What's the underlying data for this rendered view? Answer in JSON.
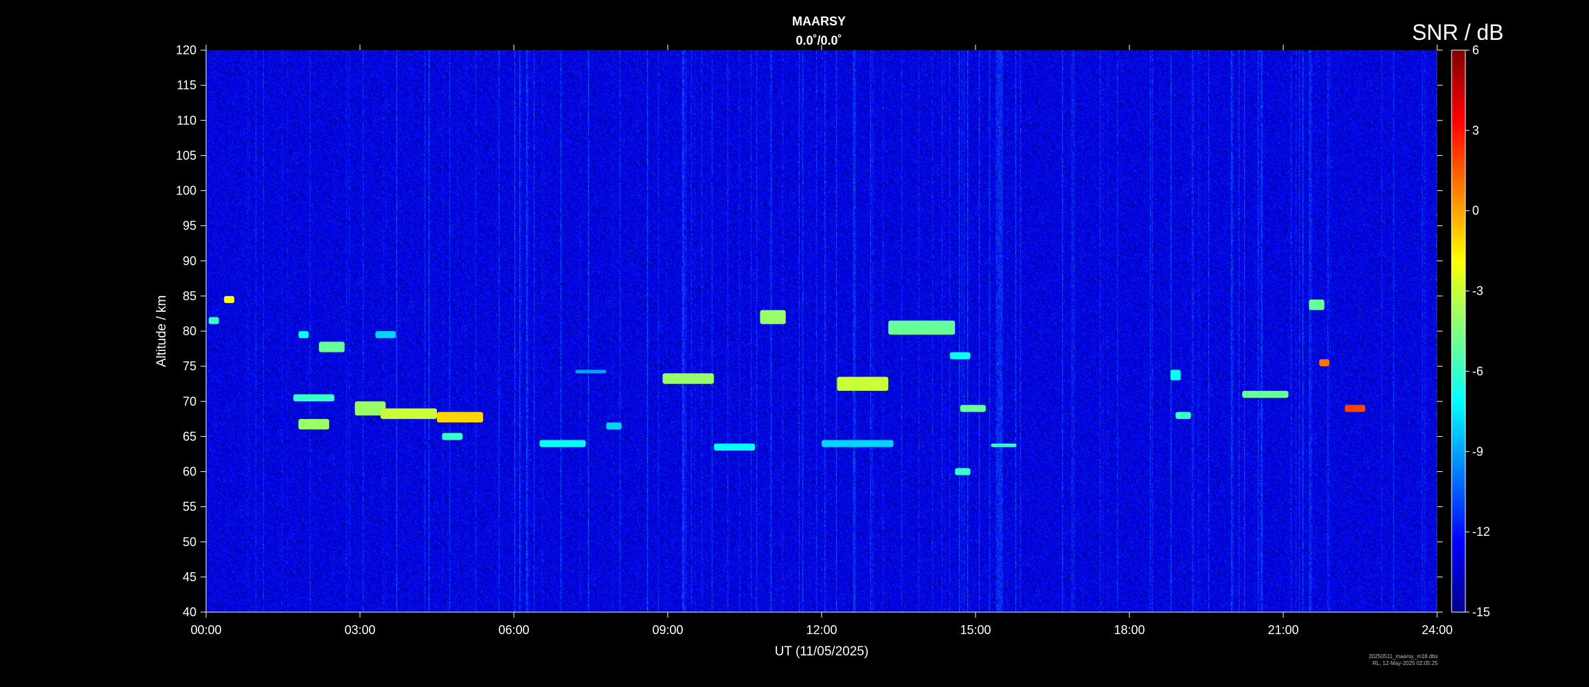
{
  "chart_data": {
    "type": "heatmap",
    "title": "MAARSY",
    "subtitle": "0.0˚/0.0˚",
    "xlabel": "UT (11/05/2025)",
    "ylabel": "Altitude / km",
    "x_ticks": [
      "00:00",
      "03:00",
      "06:00",
      "09:00",
      "12:00",
      "15:00",
      "18:00",
      "21:00",
      "24:00"
    ],
    "xlim_hours": [
      0,
      24
    ],
    "y_ticks": [
      40,
      45,
      50,
      55,
      60,
      65,
      70,
      75,
      80,
      85,
      90,
      95,
      100,
      105,
      110,
      115,
      120
    ],
    "ylim_km": [
      40,
      120
    ],
    "colorbar": {
      "label": "SNR / dB",
      "ticks": [
        6,
        3,
        0,
        -3,
        -6,
        -9,
        -12,
        -15
      ],
      "range": [
        -15,
        6
      ],
      "colormap": "jet"
    },
    "background_snr_db": -13,
    "echo_layers": [
      {
        "t_start": 0.05,
        "t_end": 0.25,
        "alt_top": 82,
        "alt_bottom": 81,
        "snr_db": -6
      },
      {
        "t_start": 0.35,
        "t_end": 0.55,
        "alt_top": 85,
        "alt_bottom": 84,
        "snr_db": -2
      },
      {
        "t_start": 1.8,
        "t_end": 2.0,
        "alt_top": 80,
        "alt_bottom": 79,
        "snr_db": -7
      },
      {
        "t_start": 2.2,
        "t_end": 2.7,
        "alt_top": 78.5,
        "alt_bottom": 77,
        "snr_db": -5
      },
      {
        "t_start": 3.3,
        "t_end": 3.7,
        "alt_top": 80,
        "alt_bottom": 79,
        "snr_db": -8
      },
      {
        "t_start": 1.7,
        "t_end": 2.5,
        "alt_top": 71,
        "alt_bottom": 70,
        "snr_db": -6
      },
      {
        "t_start": 1.8,
        "t_end": 2.4,
        "alt_top": 67.5,
        "alt_bottom": 66,
        "snr_db": -4
      },
      {
        "t_start": 2.9,
        "t_end": 3.5,
        "alt_top": 70,
        "alt_bottom": 68,
        "snr_db": -4
      },
      {
        "t_start": 3.4,
        "t_end": 4.5,
        "alt_top": 69,
        "alt_bottom": 67.5,
        "snr_db": -3
      },
      {
        "t_start": 4.5,
        "t_end": 5.4,
        "alt_top": 68.5,
        "alt_bottom": 67,
        "snr_db": -1
      },
      {
        "t_start": 4.6,
        "t_end": 5.0,
        "alt_top": 65.5,
        "alt_bottom": 64.5,
        "snr_db": -6
      },
      {
        "t_start": 6.5,
        "t_end": 7.4,
        "alt_top": 64.5,
        "alt_bottom": 63.5,
        "snr_db": -7
      },
      {
        "t_start": 7.2,
        "t_end": 7.8,
        "alt_top": 74.5,
        "alt_bottom": 74,
        "snr_db": -9
      },
      {
        "t_start": 7.8,
        "t_end": 8.1,
        "alt_top": 67,
        "alt_bottom": 66,
        "snr_db": -8
      },
      {
        "t_start": 8.9,
        "t_end": 9.9,
        "alt_top": 74,
        "alt_bottom": 72.5,
        "snr_db": -4
      },
      {
        "t_start": 9.9,
        "t_end": 10.7,
        "alt_top": 64,
        "alt_bottom": 63,
        "snr_db": -7
      },
      {
        "t_start": 10.8,
        "t_end": 11.3,
        "alt_top": 83,
        "alt_bottom": 81,
        "snr_db": -4
      },
      {
        "t_start": 12.3,
        "t_end": 13.3,
        "alt_top": 73.5,
        "alt_bottom": 71.5,
        "snr_db": -3
      },
      {
        "t_start": 13.3,
        "t_end": 14.6,
        "alt_top": 81.5,
        "alt_bottom": 79.5,
        "snr_db": -5
      },
      {
        "t_start": 12.0,
        "t_end": 13.4,
        "alt_top": 64.5,
        "alt_bottom": 63.5,
        "snr_db": -8
      },
      {
        "t_start": 14.5,
        "t_end": 14.9,
        "alt_top": 77,
        "alt_bottom": 76,
        "snr_db": -7
      },
      {
        "t_start": 14.7,
        "t_end": 15.2,
        "alt_top": 69.5,
        "alt_bottom": 68.5,
        "snr_db": -5
      },
      {
        "t_start": 15.3,
        "t_end": 15.8,
        "alt_top": 64,
        "alt_bottom": 63.5,
        "snr_db": -6
      },
      {
        "t_start": 14.6,
        "t_end": 14.9,
        "alt_top": 60.5,
        "alt_bottom": 59.5,
        "snr_db": -6
      },
      {
        "t_start": 18.8,
        "t_end": 19.0,
        "alt_top": 74.5,
        "alt_bottom": 73,
        "snr_db": -7
      },
      {
        "t_start": 18.9,
        "t_end": 19.2,
        "alt_top": 68.5,
        "alt_bottom": 67.5,
        "snr_db": -6
      },
      {
        "t_start": 20.2,
        "t_end": 21.1,
        "alt_top": 71.5,
        "alt_bottom": 70.5,
        "snr_db": -5
      },
      {
        "t_start": 21.5,
        "t_end": 21.8,
        "alt_top": 84.5,
        "alt_bottom": 83,
        "snr_db": -5
      },
      {
        "t_start": 21.7,
        "t_end": 21.9,
        "alt_top": 76,
        "alt_bottom": 75,
        "snr_db": 1
      },
      {
        "t_start": 22.2,
        "t_end": 22.6,
        "alt_top": 69.5,
        "alt_bottom": 68.5,
        "snr_db": 2
      }
    ]
  },
  "footnote": {
    "line1": "20250511_maarsy_m18.dbs",
    "line2": "RL, 12-May-2025 02:05:25"
  }
}
